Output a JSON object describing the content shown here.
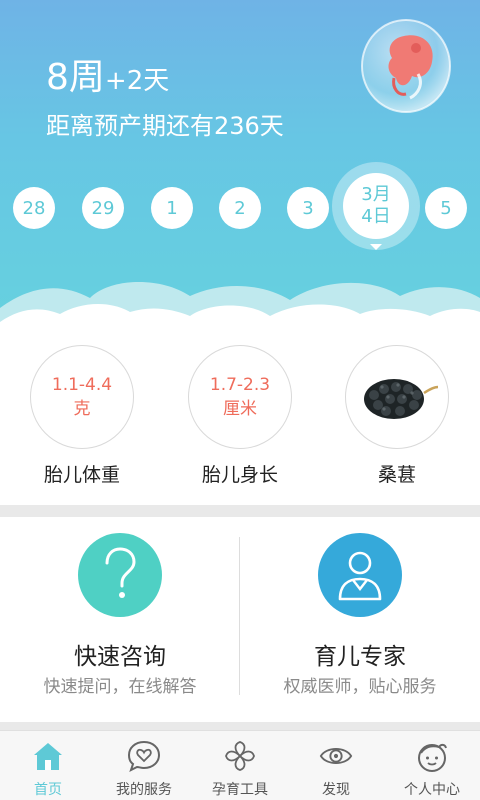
{
  "header": {
    "week_number": "8周",
    "week_extra": "+2天",
    "countdown": "距离预产期还有236天"
  },
  "dates": [
    "28",
    "29",
    "1",
    "2",
    "3"
  ],
  "selected_date": {
    "month": "3月",
    "day": "4日"
  },
  "next_date": "5",
  "metrics": [
    {
      "value_line1": "1.1-4.4",
      "value_line2": "克",
      "label": "胎儿体重"
    },
    {
      "value_line1": "1.7-2.3",
      "value_line2": "厘米",
      "label": "胎儿身长"
    },
    {
      "label": "桑葚",
      "icon": "mulberry-image"
    }
  ],
  "services": [
    {
      "title": "快速咨询",
      "subtitle": "快速提问，在线解答",
      "icon": "question-icon",
      "color": "#4fd0c4"
    },
    {
      "title": "育儿专家",
      "subtitle": "权威医师，贴心服务",
      "icon": "doctor-icon",
      "color": "#35a9da"
    }
  ],
  "tabs": [
    {
      "label": "首页",
      "icon": "home-icon",
      "active": true
    },
    {
      "label": "我的服务",
      "icon": "heart-chat-icon",
      "active": false
    },
    {
      "label": "孕育工具",
      "icon": "flower-icon",
      "active": false
    },
    {
      "label": "发现",
      "icon": "eye-icon",
      "active": false
    },
    {
      "label": "个人中心",
      "icon": "user-face-icon",
      "active": false
    }
  ],
  "colors": {
    "accent": "#5ec9d6",
    "metric_value": "#ef6c5b"
  }
}
